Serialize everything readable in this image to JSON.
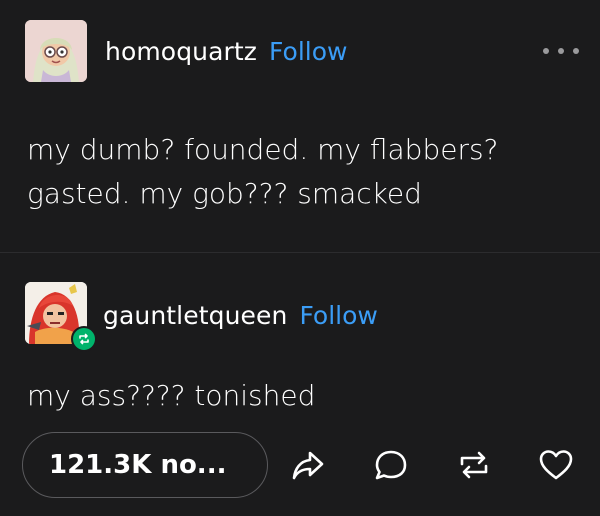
{
  "post": {
    "author": {
      "username": "homoquartz",
      "follow_label": "Follow",
      "avatar_icon": "cartoon-girl-glasses-avatar"
    },
    "more_icon": "ellipsis-icon",
    "text_line1": "my dumb? founded. my flabbers?",
    "text_line2": "gasted. my gob??? smacked"
  },
  "reblog": {
    "author": {
      "username": "gauntletqueen",
      "follow_label": "Follow",
      "avatar_icon": "red-haired-warrior-avatar",
      "badge_icon": "reblog-badge-icon"
    },
    "text": "my ass???? tonished"
  },
  "footer": {
    "notes_label": "121.3K no...",
    "actions": {
      "share_icon": "share-arrow-icon",
      "reply_icon": "speech-bubble-icon",
      "reblog_icon": "reblog-icon",
      "like_icon": "heart-icon"
    }
  },
  "colors": {
    "background": "#1b1b1c",
    "text": "#ffffff",
    "link": "#3b9df6",
    "badge": "#00b36b"
  }
}
